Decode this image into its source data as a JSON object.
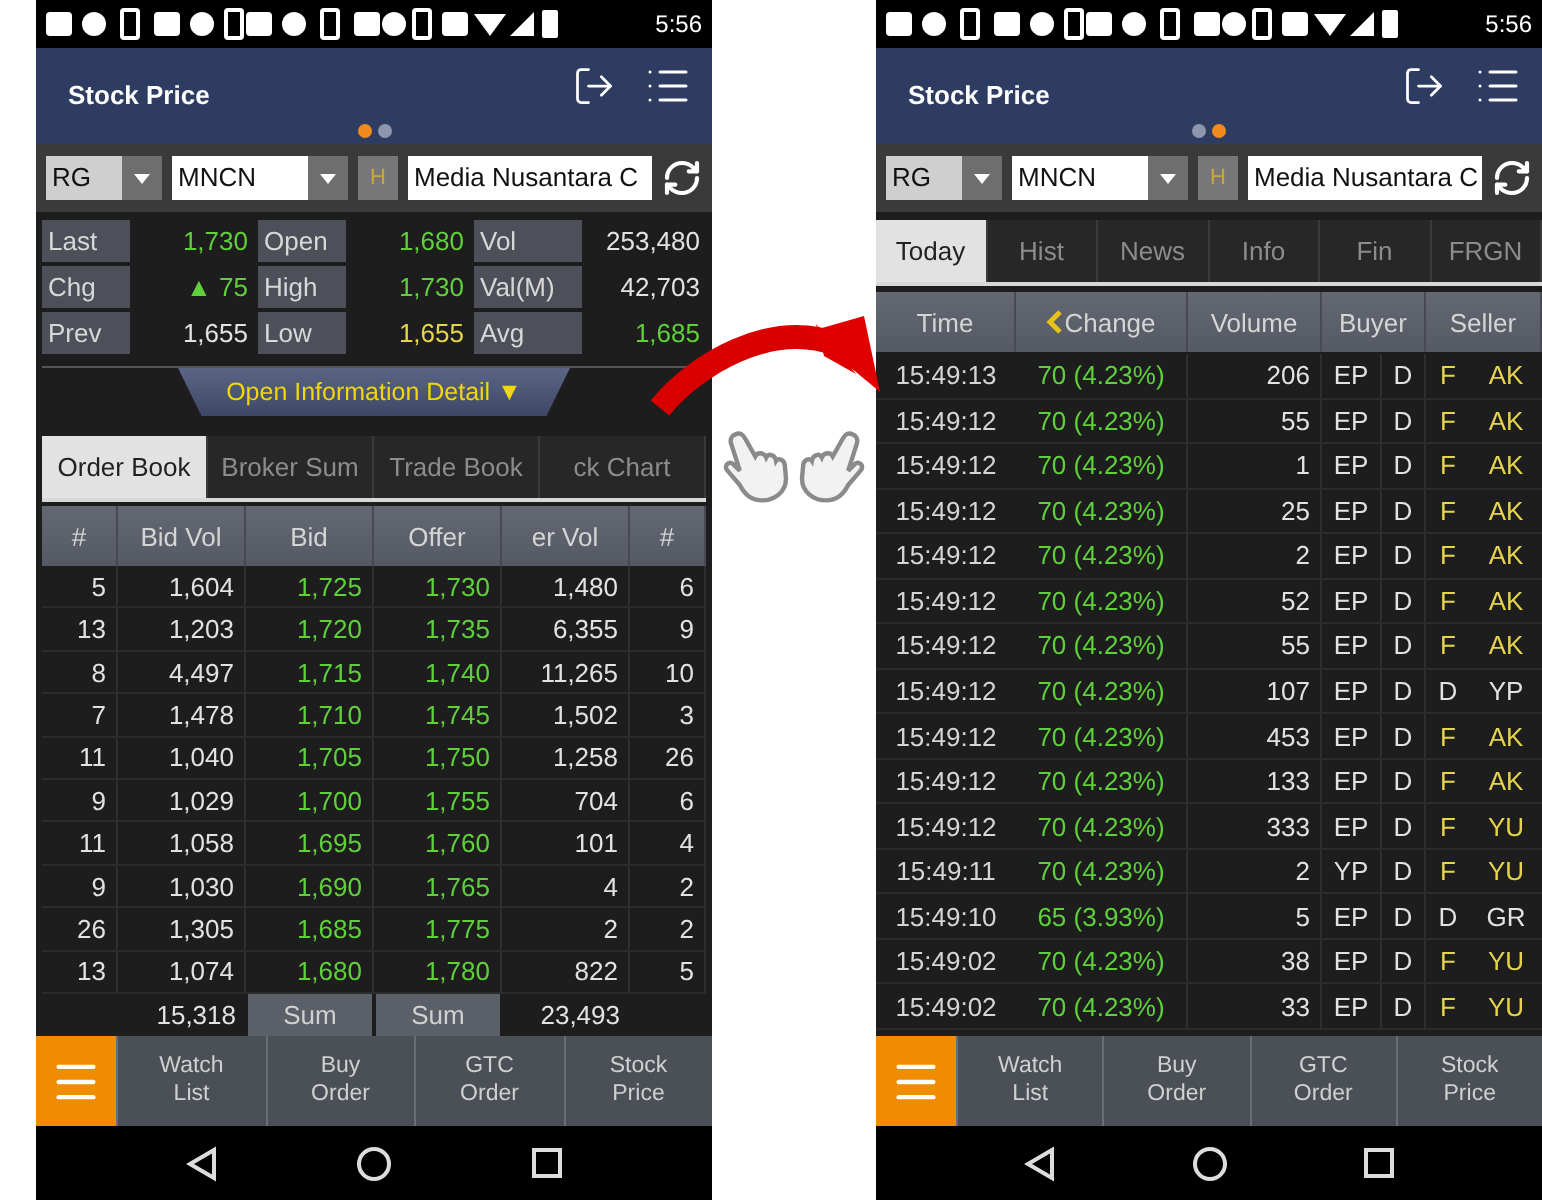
{
  "screens": [
    {
      "kind": "order_book",
      "status_bar": {
        "time": "5:56"
      },
      "header": {
        "title": "Stock Price",
        "pages": [
          {
            "selected": true
          },
          {
            "selected": false
          }
        ]
      },
      "toolbar": {
        "board": "RG",
        "code": "MNCN",
        "h_button": "H",
        "company": "Media Nusantara C"
      },
      "quote": [
        {
          "label": "Last",
          "value": "1,730",
          "color": "#5fd03a"
        },
        {
          "label": "Open",
          "value": "1,680",
          "color": "#5fd03a"
        },
        {
          "label": "Vol",
          "value": "253,480",
          "color": "#e2e2e2"
        },
        {
          "label": "Chg",
          "value": "▲ 75",
          "color": "#5fd03a"
        },
        {
          "label": "High",
          "value": "1,730",
          "color": "#5fd03a"
        },
        {
          "label": "Val(M)",
          "value": "42,703",
          "color": "#e2e2e2"
        },
        {
          "label": "Prev",
          "value": "1,655",
          "color": "#e2e2e2"
        },
        {
          "label": "Low",
          "value": "1,655",
          "color": "#e6d44a"
        },
        {
          "label": "Avg",
          "value": "1,685",
          "color": "#5fd03a"
        }
      ],
      "info_toggle": "Open Information Detail ▼",
      "tabs": [
        {
          "label": "Order Book",
          "selected": true
        },
        {
          "label": "Broker Sum",
          "selected": false
        },
        {
          "label": "Trade Book",
          "selected": false
        },
        {
          "label": "ck Chart",
          "selected": false
        }
      ],
      "table": {
        "columns": [
          {
            "label": "#",
            "color": "#e2e2e2"
          },
          {
            "label": "Bid Vol",
            "color": "#e2e2e2"
          },
          {
            "label": "Bid",
            "color": "#5fd03a"
          },
          {
            "label": "Offer",
            "color": "#5fd03a"
          },
          {
            "label": "er Vol",
            "color": "#e2e2e2"
          },
          {
            "label": "#",
            "color": "#e2e2e2"
          }
        ],
        "rows": [
          [
            "5",
            "1,604",
            "1,725",
            "1,730",
            "1,480",
            "6"
          ],
          [
            "13",
            "1,203",
            "1,720",
            "1,735",
            "6,355",
            "9"
          ],
          [
            "8",
            "4,497",
            "1,715",
            "1,740",
            "11,265",
            "10"
          ],
          [
            "7",
            "1,478",
            "1,710",
            "1,745",
            "1,502",
            "3"
          ],
          [
            "11",
            "1,040",
            "1,705",
            "1,750",
            "1,258",
            "26"
          ],
          [
            "9",
            "1,029",
            "1,700",
            "1,755",
            "704",
            "6"
          ],
          [
            "11",
            "1,058",
            "1,695",
            "1,760",
            "101",
            "4"
          ],
          [
            "9",
            "1,030",
            "1,690",
            "1,765",
            "4",
            "2"
          ],
          [
            "26",
            "1,305",
            "1,685",
            "1,775",
            "2",
            "2"
          ],
          [
            "13",
            "1,074",
            "1,680",
            "1,780",
            "822",
            "5"
          ]
        ],
        "summary": {
          "bid_vol": "15,318",
          "bid": "Sum",
          "offer": "Sum",
          "offer_vol": "23,493"
        }
      },
      "bottom_nav": [
        "Watch List",
        "Buy Order",
        "GTC Order",
        "Stock Price"
      ]
    },
    {
      "kind": "trade_list",
      "status_bar": {
        "time": "5:56"
      },
      "header": {
        "title": "Stock Price",
        "pages": [
          {
            "selected": false
          },
          {
            "selected": true
          }
        ]
      },
      "toolbar": {
        "board": "RG",
        "code": "MNCN",
        "h_button": "H",
        "company": "Media Nusantara C"
      },
      "tabs": [
        {
          "label": "Today",
          "selected": true
        },
        {
          "label": "Hist",
          "selected": false
        },
        {
          "label": "News",
          "selected": false
        },
        {
          "label": "Info",
          "selected": false
        },
        {
          "label": "Fin",
          "selected": false
        },
        {
          "label": "FRGN",
          "selected": false
        }
      ],
      "columns": [
        "Time",
        "Change",
        "Volume",
        "Buyer",
        "Seller"
      ],
      "rows": [
        {
          "time": "15:49:13",
          "change": "70 (4.23%)",
          "volume": "206",
          "buyer": "EP",
          "buyer_type": "D",
          "seller_type": "F",
          "seller": "AK",
          "seller_foreign": true
        },
        {
          "time": "15:49:12",
          "change": "70 (4.23%)",
          "volume": "55",
          "buyer": "EP",
          "buyer_type": "D",
          "seller_type": "F",
          "seller": "AK",
          "seller_foreign": true
        },
        {
          "time": "15:49:12",
          "change": "70 (4.23%)",
          "volume": "1",
          "buyer": "EP",
          "buyer_type": "D",
          "seller_type": "F",
          "seller": "AK",
          "seller_foreign": true
        },
        {
          "time": "15:49:12",
          "change": "70 (4.23%)",
          "volume": "25",
          "buyer": "EP",
          "buyer_type": "D",
          "seller_type": "F",
          "seller": "AK",
          "seller_foreign": true
        },
        {
          "time": "15:49:12",
          "change": "70 (4.23%)",
          "volume": "2",
          "buyer": "EP",
          "buyer_type": "D",
          "seller_type": "F",
          "seller": "AK",
          "seller_foreign": true
        },
        {
          "time": "15:49:12",
          "change": "70 (4.23%)",
          "volume": "52",
          "buyer": "EP",
          "buyer_type": "D",
          "seller_type": "F",
          "seller": "AK",
          "seller_foreign": true
        },
        {
          "time": "15:49:12",
          "change": "70 (4.23%)",
          "volume": "55",
          "buyer": "EP",
          "buyer_type": "D",
          "seller_type": "F",
          "seller": "AK",
          "seller_foreign": true
        },
        {
          "time": "15:49:12",
          "change": "70 (4.23%)",
          "volume": "107",
          "buyer": "EP",
          "buyer_type": "D",
          "seller_type": "D",
          "seller": "YP",
          "seller_foreign": false
        },
        {
          "time": "15:49:12",
          "change": "70 (4.23%)",
          "volume": "453",
          "buyer": "EP",
          "buyer_type": "D",
          "seller_type": "F",
          "seller": "AK",
          "seller_foreign": true
        },
        {
          "time": "15:49:12",
          "change": "70 (4.23%)",
          "volume": "133",
          "buyer": "EP",
          "buyer_type": "D",
          "seller_type": "F",
          "seller": "AK",
          "seller_foreign": true
        },
        {
          "time": "15:49:12",
          "change": "70 (4.23%)",
          "volume": "333",
          "buyer": "EP",
          "buyer_type": "D",
          "seller_type": "F",
          "seller": "YU",
          "seller_foreign": true
        },
        {
          "time": "15:49:11",
          "change": "70 (4.23%)",
          "volume": "2",
          "buyer": "YP",
          "buyer_type": "D",
          "seller_type": "F",
          "seller": "YU",
          "seller_foreign": true
        },
        {
          "time": "15:49:10",
          "change": "65 (3.93%)",
          "volume": "5",
          "buyer": "EP",
          "buyer_type": "D",
          "seller_type": "D",
          "seller": "GR",
          "seller_foreign": false
        },
        {
          "time": "15:49:02",
          "change": "70 (4.23%)",
          "volume": "38",
          "buyer": "EP",
          "buyer_type": "D",
          "seller_type": "F",
          "seller": "YU",
          "seller_foreign": true
        },
        {
          "time": "15:49:02",
          "change": "70 (4.23%)",
          "volume": "33",
          "buyer": "EP",
          "buyer_type": "D",
          "seller_type": "F",
          "seller": "YU",
          "seller_foreign": true
        }
      ],
      "bottom_nav": [
        "Watch List",
        "Buy Order",
        "GTC Order",
        "Stock Price"
      ]
    }
  ]
}
